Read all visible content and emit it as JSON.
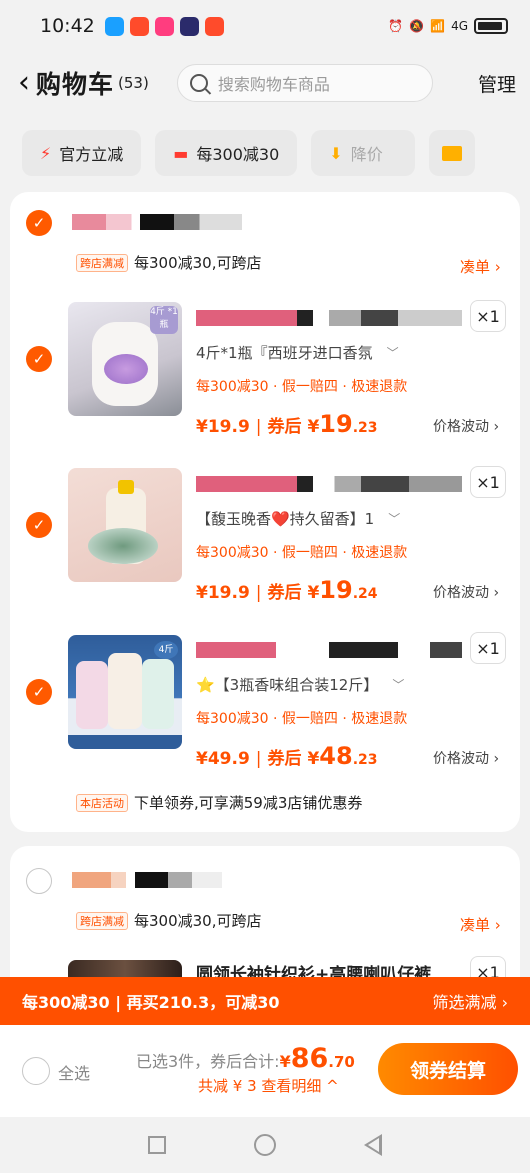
{
  "status_bar": {
    "time": "10:42",
    "app_icon_colors": [
      "#1aa0ff",
      "#ff4b2b",
      "#ff3d7f",
      "#2b2b6b",
      "#ff4b2b"
    ],
    "signal": "4G"
  },
  "header": {
    "title": "购物车",
    "count": "(53)",
    "search_placeholder": "搜索购物车商品",
    "manage": "管理"
  },
  "filters": [
    {
      "label": "官方立减",
      "icon": "lightning-icon"
    },
    {
      "label": "每300减30",
      "icon": "coupon-icon"
    },
    {
      "label": "降价",
      "icon": "down-arrow-icon"
    }
  ],
  "shop1": {
    "tag": "跨店满减",
    "promo": "每300减30,可跨店",
    "coudan": "凑单 ›",
    "items": [
      {
        "spec": "4斤*1瓶『西班牙进口香氛",
        "qty": "×1",
        "services": "每300减30 · 假一赔四 · 极速退款",
        "price": "¥19.9",
        "after_label": "券后",
        "after_yen": "¥",
        "after_int": "19",
        "after_dec": ".23",
        "wave": "价格波动 ›",
        "img_badge": "4斤 *1瓶"
      },
      {
        "spec": "【馥玉晚香❤️持久留香】1",
        "qty": "×1",
        "services": "每300减30 · 假一赔四 · 极速退款",
        "price": "¥19.9",
        "after_label": "券后",
        "after_yen": "¥",
        "after_int": "19",
        "after_dec": ".24",
        "wave": "价格波动 ›",
        "img_badge": ""
      },
      {
        "spec": "⭐【3瓶香味组合装12斤】",
        "qty": "×1",
        "services": "每300减30 · 假一赔四 · 极速退款",
        "price": "¥49.9",
        "after_label": "券后",
        "after_yen": "¥",
        "after_int": "48",
        "after_dec": ".23",
        "wave": "价格波动 ›",
        "img_badge": "4斤"
      }
    ],
    "shop_tag": "本店活动",
    "shop_promo": "下单领券,可享满59减3店铺优惠券"
  },
  "shop2": {
    "tag": "跨店满减",
    "promo": "每300减30,可跨店",
    "coudan": "凑单 ›",
    "item_title": "圆领长袖针织衫+高腰喇叭仔裤",
    "qty": "×1"
  },
  "promo_bar": {
    "left": "每300减30 | 再买210.3，可减30",
    "right": "筛选满减 ›"
  },
  "bottom": {
    "select_all": "全选",
    "summary_label": "已选3件，券后合计:",
    "yen": "¥",
    "total_int": "86",
    "total_dec": ".70",
    "discount": "共减 ¥ 3  查看明细 ^",
    "checkout": "领券结算"
  },
  "colors": {
    "accent": "#ff5000",
    "background": "#f2f2f2"
  }
}
